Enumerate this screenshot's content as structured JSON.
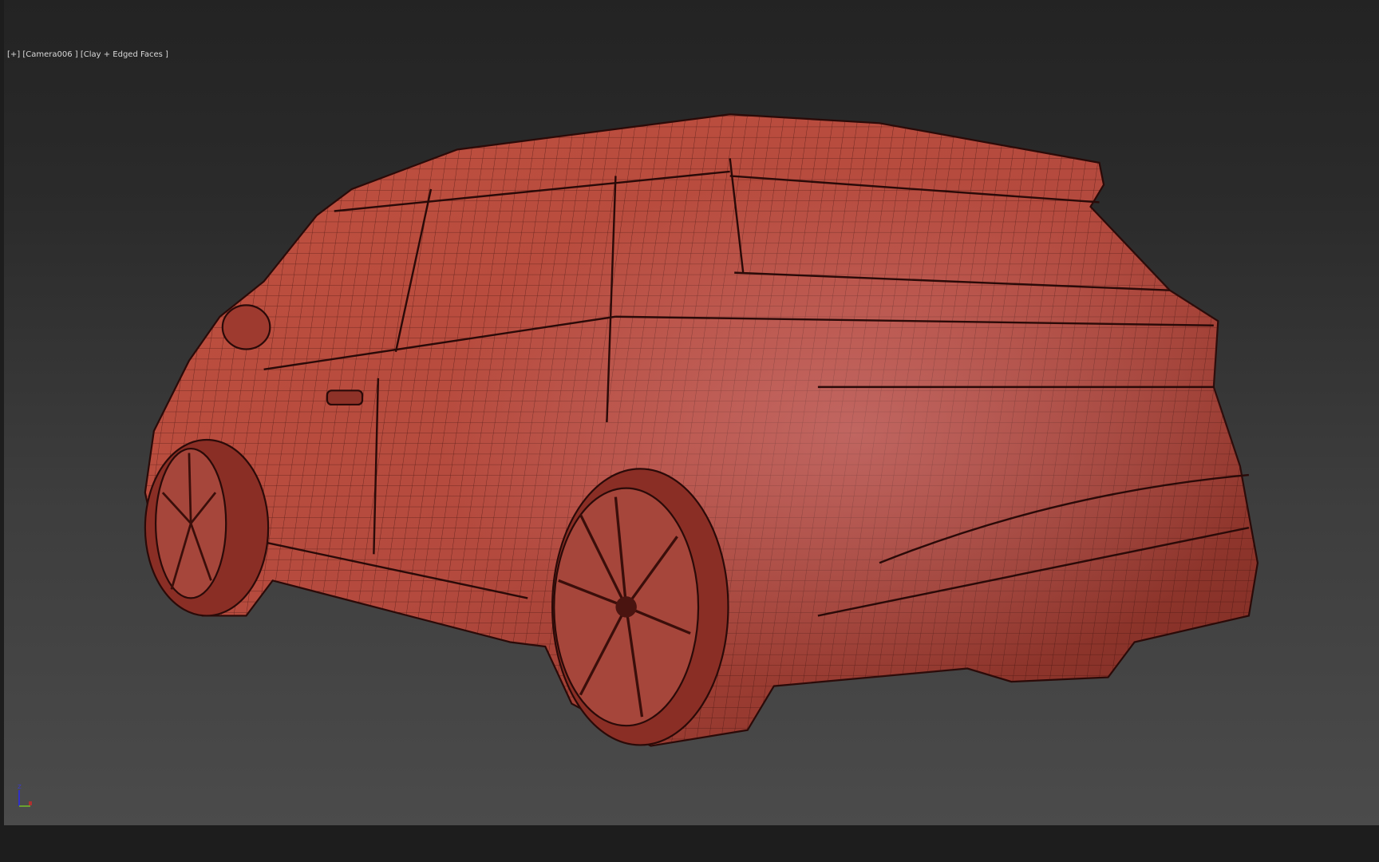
{
  "viewport": {
    "label": "[+] [Camera006 ] [Clay + Edged Faces ]",
    "gizmo_axis": "Z",
    "model_color": "#b5483b",
    "wire_color": "#3a0e0a",
    "background_top": "#232323",
    "background_bottom": "#4b4b4b"
  }
}
